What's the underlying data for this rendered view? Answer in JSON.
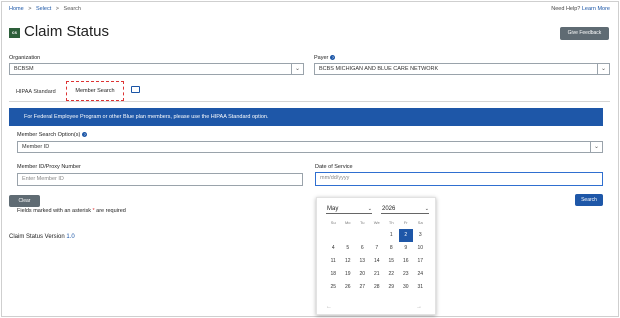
{
  "breadcrumb": {
    "home": "Home",
    "sep1": ">",
    "select": "Select",
    "sep2": ">",
    "search": "Search"
  },
  "help": {
    "prefix": "Need Help?",
    "link": "Learn More"
  },
  "logo_text": "cs",
  "page_title": "Claim Status",
  "feedback_label": "Give Feedback",
  "organization": {
    "label": "Organization",
    "value": "BCBSM"
  },
  "payer": {
    "label": "Payer",
    "value": "BCBS MICHIGAN AND BLUE CARE NETWORK"
  },
  "tabs": [
    {
      "label": "HIPAA Standard"
    },
    {
      "label": "Member Search"
    }
  ],
  "banner": "For Federal Employee Program or other Blue plan members, please use the HIPAA Standard option.",
  "search_options": {
    "label": "Member Search Option(s)",
    "value": "Member ID"
  },
  "member_id": {
    "label": "Member ID/Proxy Number",
    "placeholder": "Enter Member ID"
  },
  "date_of_service": {
    "label": "Date of Service",
    "placeholder": "mm/dd/yyyy"
  },
  "clear_label": "Clear",
  "search_label": "Search",
  "required_note": {
    "prefix": "Fields marked with an asterisk ",
    "star": "*",
    "suffix": " are required"
  },
  "version": {
    "label": "Claim Status Version",
    "number": "1.0"
  },
  "calendar": {
    "month": "May",
    "year": "2026",
    "weekdays": [
      "Su",
      "Mo",
      "Tu",
      "We",
      "Th",
      "Fr",
      "Sa"
    ],
    "weeks": [
      [
        "",
        "",
        "",
        "",
        "1",
        "2",
        "3"
      ],
      [
        "4",
        "5",
        "6",
        "7",
        "8",
        "9",
        "10"
      ],
      [
        "11",
        "12",
        "13",
        "14",
        "15",
        "16",
        "17"
      ],
      [
        "18",
        "19",
        "20",
        "21",
        "22",
        "23",
        "24"
      ],
      [
        "25",
        "26",
        "27",
        "28",
        "29",
        "30",
        "31"
      ]
    ],
    "selected_day": "2",
    "prev": "←",
    "next": "→"
  }
}
